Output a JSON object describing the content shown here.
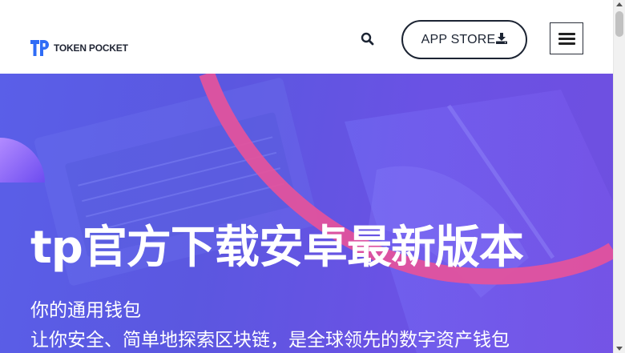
{
  "header": {
    "logo_text": "TOKEN POCKET",
    "logo_icon": "tp-logo-icon",
    "search_icon": "search-icon",
    "app_store_label": "APP STORE",
    "download_icon": "download-icon",
    "menu_icon": "hamburger-menu-icon"
  },
  "hero": {
    "title": "tp官方下载安卓最新版本",
    "subtitle_line1": "你的通用钱包",
    "subtitle_line2": "让你安全、简单地探索区块链，是全球领先的数字资产钱包"
  },
  "colors": {
    "brand_blue": "#2f6cf6",
    "hero_purple": "#5b57e0",
    "arc_pink": "#e5539b",
    "dark_text": "#1c2433"
  }
}
